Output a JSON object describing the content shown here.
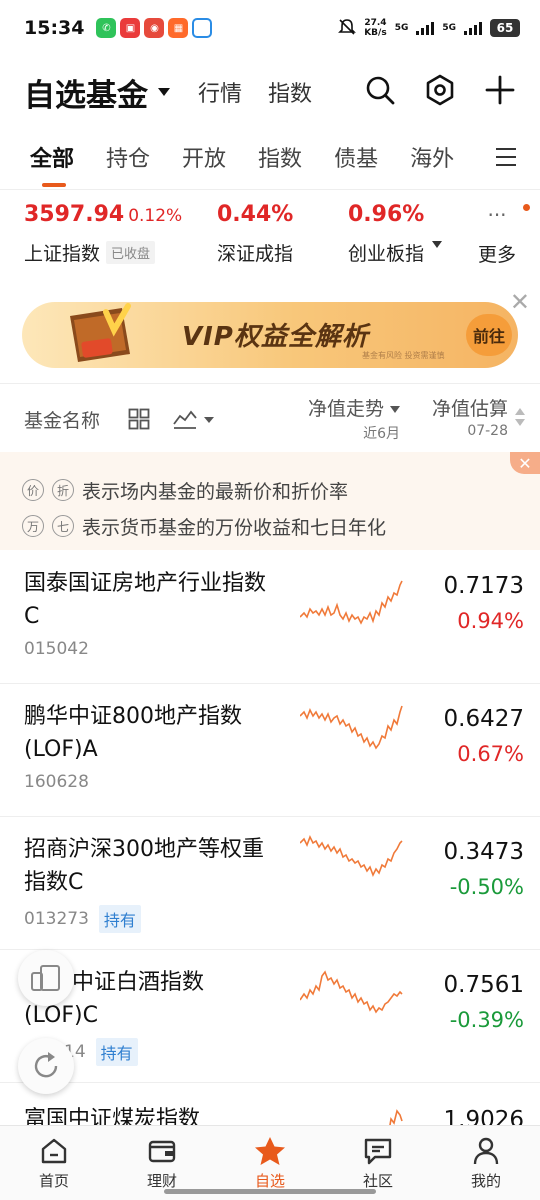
{
  "status_bar": {
    "time": "15:34",
    "net_speed_value": "27.4",
    "net_speed_unit": "KB/s",
    "network_1": "5G",
    "network_2": "5G",
    "battery": "65"
  },
  "header": {
    "title": "自选基金",
    "link_market": "行情",
    "link_index": "指数"
  },
  "tabs": [
    "全部",
    "持仓",
    "开放",
    "指数",
    "债基",
    "海外"
  ],
  "indices": [
    {
      "value": "3597.94",
      "change": "0.12%",
      "name": "上证指数",
      "badge": "已收盘"
    },
    {
      "value": "0.44%",
      "name": "深证成指"
    },
    {
      "value": "0.96%",
      "name": "创业板指"
    }
  ],
  "more_label": "更多",
  "more_dots": "···",
  "banner": {
    "text": "VIP权益全解析",
    "button": "前往",
    "fine_print": "基金有风险 投资需谨慎"
  },
  "list_header": {
    "name_col": "基金名称",
    "trend_col": "净值走势",
    "trend_sub": "近6月",
    "est_col": "净值估算",
    "est_sub": "07-28"
  },
  "notice": {
    "line1_tag1": "价",
    "line1_tag2": "折",
    "line1_text": "表示场内基金的最新价和折价率",
    "line2_tag1": "万",
    "line2_tag2": "七",
    "line2_text": "表示货币基金的万份收益和七日年化"
  },
  "funds": [
    {
      "name": "国泰国证房地产行业指数C",
      "code": "015042",
      "held": "",
      "nav": "0.7173",
      "change": "0.94%",
      "direction": "up"
    },
    {
      "name": "鹏华中证800地产指数(LOF)A",
      "code": "160628",
      "held": "",
      "nav": "0.6427",
      "change": "0.67%",
      "direction": "up"
    },
    {
      "name": "招商沪深300地产等权重指数C",
      "code": "013273",
      "held": "持有",
      "nav": "0.3473",
      "change": "-0.50%",
      "direction": "down"
    },
    {
      "name": "中证白酒指数(LOF)C",
      "code": "14",
      "held": "持有",
      "nav": "0.7561",
      "change": "-0.39%",
      "direction": "down"
    },
    {
      "name": "富国中证煤炭指数",
      "code": "",
      "held": "",
      "nav": "1.9026",
      "change": "",
      "direction": "up"
    }
  ],
  "bottom_nav": [
    {
      "label": "首页",
      "icon": "home-icon"
    },
    {
      "label": "理财",
      "icon": "wallet-icon"
    },
    {
      "label": "自选",
      "icon": "star-icon"
    },
    {
      "label": "社区",
      "icon": "chat-icon"
    },
    {
      "label": "我的",
      "icon": "user-icon"
    }
  ],
  "colors": {
    "accent": "#e85a1c",
    "up": "#e02727",
    "down": "#1a9a3a",
    "sparkline": "#f07a3a"
  }
}
